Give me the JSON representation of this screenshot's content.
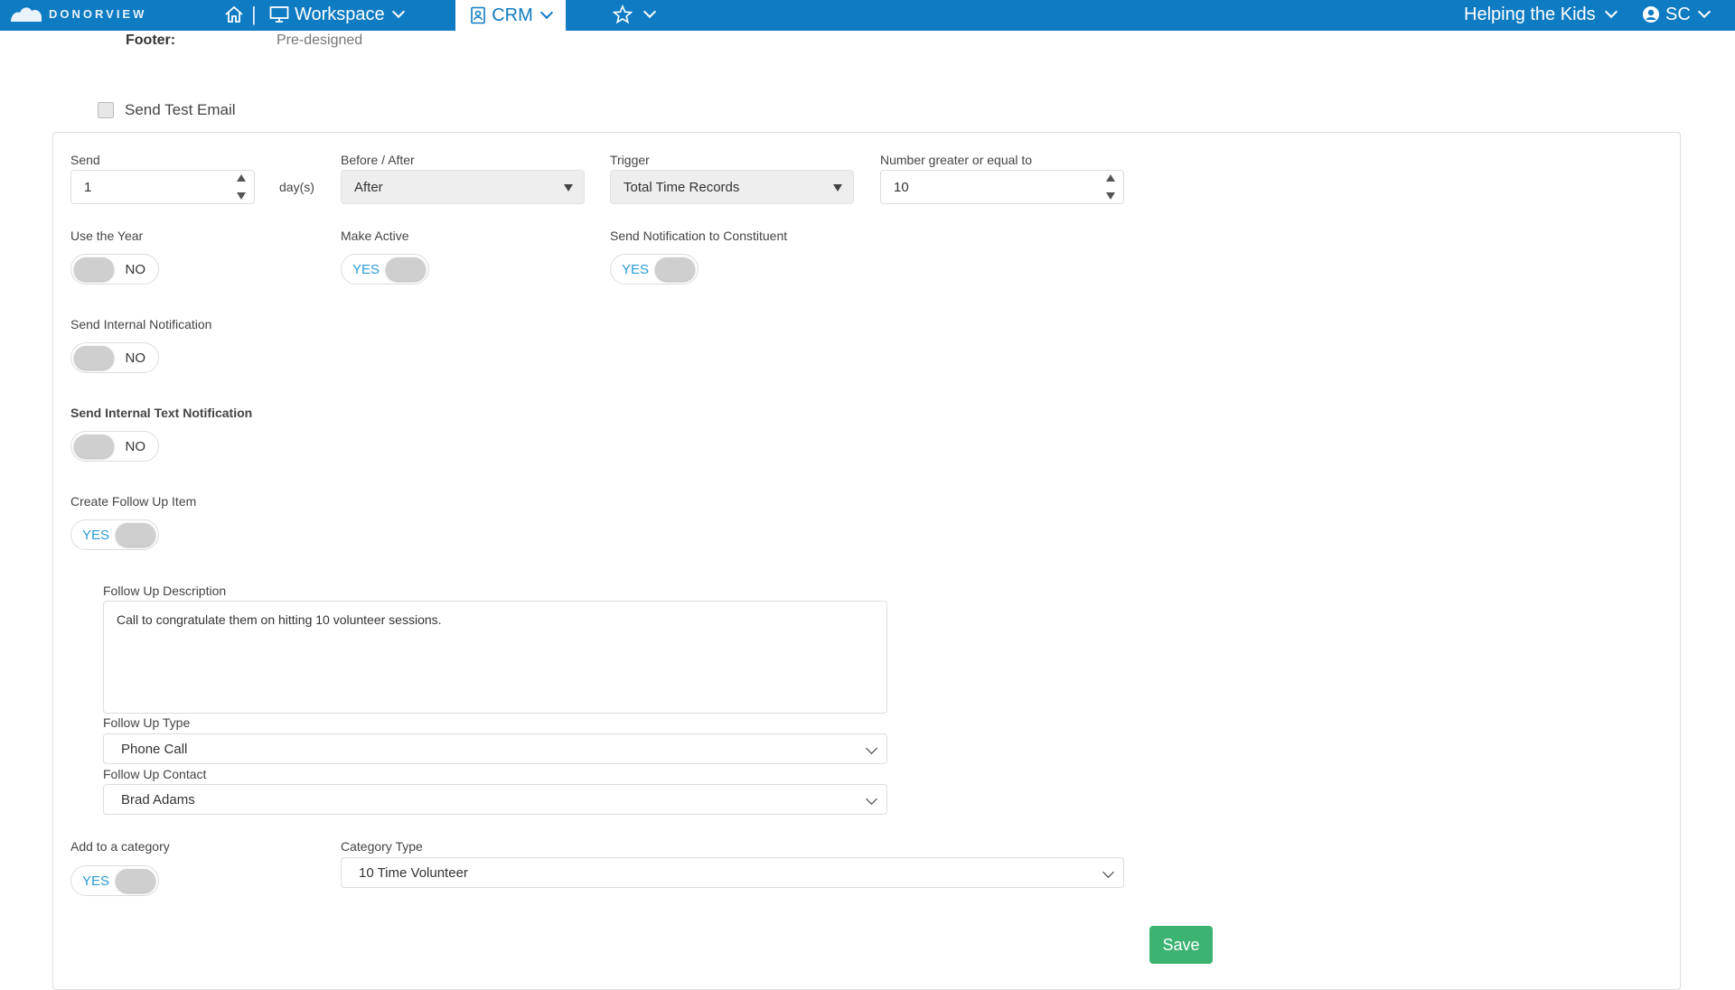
{
  "topbar": {
    "brand": "DONORVIEW",
    "home_icon": "home-icon",
    "separator": "|",
    "workspace_label": "Workspace",
    "crm_label": "CRM",
    "org_name": "Helping the Kids",
    "user_initials": "SC",
    "color": "#0f7bc2"
  },
  "footer_row": {
    "label": "Footer:",
    "value": "Pre-designed"
  },
  "test_email": {
    "label": "Send Test Email",
    "checked": false
  },
  "send": {
    "label": "Send",
    "value": "1",
    "unit": "day(s)"
  },
  "before_after": {
    "label": "Before / After",
    "value": "After"
  },
  "trigger": {
    "label": "Trigger",
    "value": "Total Time Records"
  },
  "number_gte": {
    "label": "Number greater or equal to",
    "value": "10"
  },
  "use_year": {
    "label": "Use the Year",
    "state": "NO"
  },
  "make_active": {
    "label": "Make Active",
    "state": "YES"
  },
  "notify_constituent": {
    "label": "Send Notification to Constituent",
    "state": "YES"
  },
  "internal_notification": {
    "label": "Send Internal Notification",
    "state": "NO"
  },
  "internal_text": {
    "label": "Send Internal Text Notification",
    "state": "NO"
  },
  "follow_up": {
    "label": "Create Follow Up Item",
    "state": "YES"
  },
  "follow_up_description": {
    "label": "Follow Up Description",
    "value": "Call to congratulate them on hitting 10 volunteer sessions."
  },
  "follow_up_type": {
    "label": "Follow Up Type",
    "value": "Phone Call"
  },
  "follow_up_contact": {
    "label": "Follow Up Contact",
    "value": "Brad Adams"
  },
  "add_category": {
    "label": "Add to a category",
    "state": "YES"
  },
  "category_type": {
    "label": "Category Type",
    "value": "10 Time Volunteer"
  },
  "save_label": "Save",
  "save_color": "#3cb371"
}
